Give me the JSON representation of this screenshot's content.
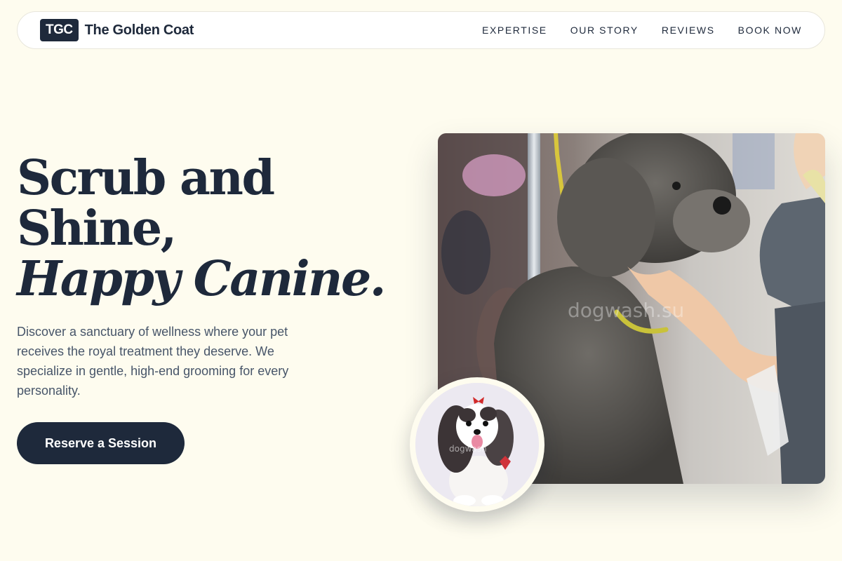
{
  "nav": {
    "logo_mark": "TGC",
    "brand_name": "The Golden Coat",
    "links": [
      "EXPERTISE",
      "OUR STORY",
      "REVIEWS",
      "BOOK NOW"
    ]
  },
  "hero": {
    "title_line1": "Scrub and",
    "title_line2": "Shine,",
    "title_line3": "Happy Canine.",
    "description": "Discover a sanctuary of wellness where your pet receives the royal treatment they deserve. We specialize in gentle, high-end grooming for every personality.",
    "cta_label": "Reserve a Session",
    "main_photo_watermark": "dogwash.su",
    "inset_photo_watermark": "dogwash"
  },
  "colors": {
    "page_background": "#fefcef",
    "navy": "#1e293b",
    "body_text": "#475569"
  }
}
